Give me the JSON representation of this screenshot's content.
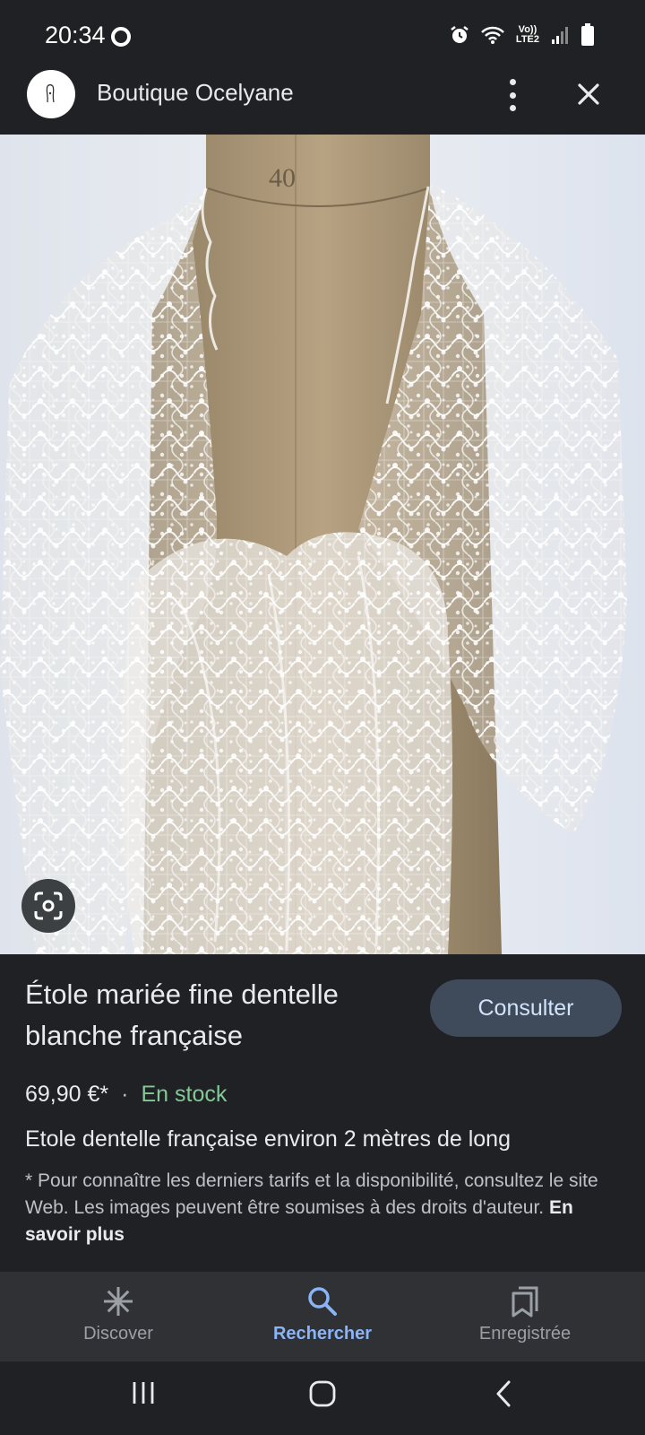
{
  "status_bar": {
    "time": "20:34",
    "network_label_top": "Vo))",
    "network_label_bottom": "LTE2",
    "icons": [
      "sync-icon",
      "alarm-icon",
      "wifi-icon",
      "signal-icon",
      "battery-icon"
    ]
  },
  "header": {
    "site_name": "Boutique Ocelyane",
    "logo_icon": "boutique-logo-icon",
    "more_icon": "more-vertical-icon",
    "close_icon": "close-icon"
  },
  "image": {
    "mannequin_size_label": "40",
    "lens_icon": "lens-icon"
  },
  "product": {
    "title": "Étole mariée fine dentelle blanche française",
    "consult_label": "Consulter",
    "price": "69,90 €*",
    "separator": "·",
    "stock": "En stock",
    "description": "Etole dentelle française environ 2 mètres de long",
    "disclaimer": "* Pour connaître les derniers tarifs et la disponibilité, consultez le site Web. Les images peuvent être soumises à des droits d'auteur.",
    "learn_more": "En savoir plus",
    "colors": {
      "stock": "#81c995",
      "button_bg": "#3f4a5a",
      "button_text": "#d2e3fc"
    }
  },
  "bottom_nav": {
    "items": [
      {
        "label": "Discover",
        "icon": "asterisk-icon",
        "active": false
      },
      {
        "label": "Rechercher",
        "icon": "search-icon",
        "active": true
      },
      {
        "label": "Enregistrée",
        "icon": "collections-icon",
        "active": false
      }
    ],
    "active_color": "#8ab4f8"
  },
  "system_nav": {
    "icons": [
      "recent-apps-icon",
      "home-icon",
      "back-icon"
    ]
  }
}
